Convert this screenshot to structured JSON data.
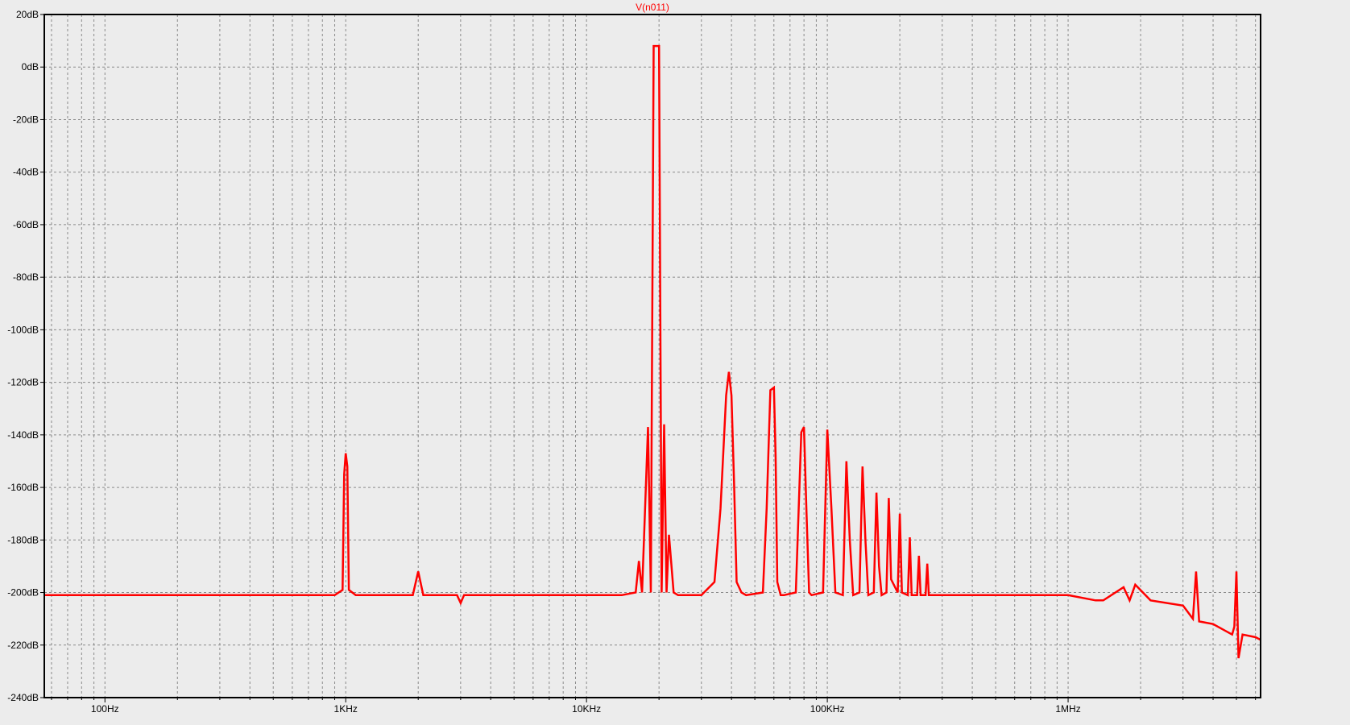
{
  "chart_data": {
    "type": "line",
    "title": "V(n011)",
    "xlabel": "",
    "ylabel": "",
    "x_scale": "log",
    "xlim": [
      56,
      6300000
    ],
    "ylim": [
      -240,
      20
    ],
    "y_ticks": [
      20,
      0,
      -20,
      -40,
      -60,
      -80,
      -100,
      -120,
      -140,
      -160,
      -180,
      -200,
      -220,
      -240
    ],
    "y_tick_labels": [
      "20dB",
      "0dB",
      "-20dB",
      "-40dB",
      "-60dB",
      "-80dB",
      "-100dB",
      "-120dB",
      "-140dB",
      "-160dB",
      "-180dB",
      "-200dB",
      "-220dB",
      "-240dB"
    ],
    "x_ticks": [
      100,
      1000,
      10000,
      100000,
      1000000
    ],
    "x_tick_labels": [
      "100Hz",
      "1KHz",
      "10KHz",
      "100KHz",
      "1MHz"
    ],
    "grid": true,
    "colors": {
      "trace": "#ff0000",
      "grid": "#8a8a8a",
      "frame": "#000000",
      "background": "#ececec",
      "title": "#ff0000"
    },
    "series": [
      {
        "name": "V(n011)",
        "x": [
          56,
          900,
          970,
          985,
          1000,
          1015,
          1030,
          1100,
          1900,
          2000,
          2100,
          2900,
          3000,
          3100,
          5000,
          14000,
          16000,
          16500,
          17000,
          18000,
          18500,
          19000,
          19500,
          20000,
          20500,
          21000,
          21500,
          22000,
          23000,
          24000,
          30000,
          34000,
          36000,
          38000,
          39000,
          40000,
          41000,
          42000,
          44000,
          46000,
          54000,
          56000,
          58000,
          60000,
          61000,
          62000,
          64000,
          66000,
          74000,
          78000,
          80000,
          82000,
          84000,
          86000,
          96000,
          100000,
          104000,
          108000,
          116000,
          120000,
          124000,
          128000,
          136000,
          140000,
          144000,
          148000,
          156000,
          160000,
          164000,
          168000,
          176000,
          180000,
          184000,
          196000,
          200000,
          204000,
          216000,
          220000,
          224000,
          236000,
          240000,
          244000,
          256000,
          260000,
          264000,
          300000,
          500000,
          800000,
          1000000,
          1300000,
          1400000,
          1700000,
          1800000,
          1900000,
          2200000,
          3000000,
          3300000,
          3400000,
          3500000,
          4000000,
          4800000,
          4900000,
          5000000,
          5100000,
          5300000,
          6000000,
          6300000
        ],
        "y": [
          -201,
          -201,
          -199,
          -155,
          -147,
          -152,
          -199,
          -201,
          -201,
          -192,
          -201,
          -201,
          -204,
          -201,
          -201,
          -201,
          -200,
          -188,
          -200,
          -137,
          -200,
          8,
          8,
          8,
          -200,
          -136,
          -200,
          -178,
          -200,
          -201,
          -201,
          -196,
          -168,
          -125,
          -116,
          -125,
          -158,
          -196,
          -200,
          -201,
          -200,
          -168,
          -123,
          -122,
          -148,
          -196,
          -201,
          -201,
          -200,
          -139,
          -137,
          -170,
          -200,
          -201,
          -200,
          -138,
          -168,
          -200,
          -201,
          -150,
          -180,
          -201,
          -200,
          -152,
          -180,
          -201,
          -200,
          -162,
          -190,
          -201,
          -200,
          -164,
          -195,
          -200,
          -170,
          -200,
          -201,
          -179,
          -201,
          -201,
          -186,
          -201,
          -201,
          -189,
          -201,
          -201,
          -201,
          -201,
          -201,
          -203,
          -203,
          -198,
          -203,
          -197,
          -203,
          -205,
          -210,
          -192,
          -211,
          -212,
          -216,
          -213,
          -192,
          -225,
          -216,
          -217,
          -218
        ]
      }
    ]
  }
}
